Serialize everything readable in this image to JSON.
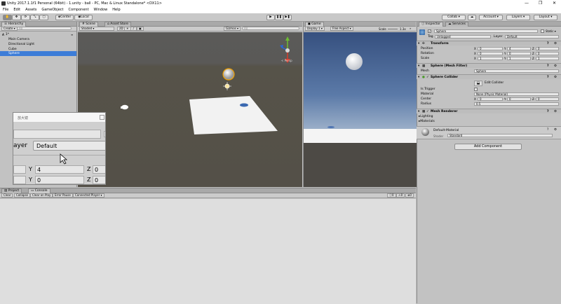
{
  "window": {
    "title": "Unity 2017.1.1f1 Personal (64bit) - 1.unity - ball - PC, Mac & Linux Standalone* <DX11>"
  },
  "menu": [
    "File",
    "Edit",
    "Assets",
    "GameObject",
    "Component",
    "Window",
    "Help"
  ],
  "toolbar": {
    "pivot": "Center",
    "space": "Local",
    "collab": "Collab ▾",
    "account": "Account ▾",
    "layers": "Layers",
    "layout": "Layout"
  },
  "hierarchy": {
    "tab": "Hierarchy",
    "create": "Create ▾",
    "search_placeholder": "All",
    "scene": "1*",
    "items": [
      "Main Camera",
      "Directional Light",
      "Cube",
      "Sphere"
    ]
  },
  "scene": {
    "tab_scene": "Scene",
    "tab_asset_store": "Asset Store",
    "shading": "Shaded",
    "mode2d": "2D",
    "gizmos": "Gizmos ▾",
    "search_placeholder": "All",
    "persp": "< Persp"
  },
  "game": {
    "tab": "Game",
    "display": "Display 1",
    "aspect": "Free Aspect",
    "scale": "Scale",
    "scale_val": "1.3x",
    "maximize": "Maximize On Play",
    "mute": "Mute Audio",
    "stats": "Stats"
  },
  "magnifier": {
    "title": "放大镜",
    "layer_label": "ayer",
    "layer_value": "Default",
    "y1_label": "Y",
    "y1_value": "4",
    "z1_label": "Z",
    "z1_value": "0",
    "y2_label": "Y",
    "y2_value": "0",
    "z2_label": "Z",
    "z2_value": "0"
  },
  "bottom": {
    "tab_project": "Project",
    "tab_console": "Console",
    "buttons": [
      "Clear",
      "Collapse",
      "Clear on Play",
      "Error Pause",
      "Connected Player ▾"
    ],
    "counts": [
      "0",
      "0",
      "0"
    ]
  },
  "inspector": {
    "tab": "Inspector",
    "tab_services": "Services",
    "object_name": "Sphere",
    "static": "Static ▾",
    "tag_label": "Tag",
    "tag_value": "Untagged",
    "layer_label": "Layer",
    "layer_value": "Default",
    "transform": {
      "title": "Transform",
      "position": {
        "label": "Position",
        "x": "0",
        "y": "4",
        "z": "0"
      },
      "rotation": {
        "label": "Rotation",
        "x": "0",
        "y": "0",
        "z": "0"
      },
      "scale": {
        "label": "Scale",
        "x": "1",
        "y": "1",
        "z": "1"
      }
    },
    "mesh_filter": {
      "title": "Sphere (Mesh Filter)",
      "mesh_label": "Mesh",
      "mesh_value": "Sphere"
    },
    "sphere_collider": {
      "title": "Sphere Collider",
      "edit": "Edit Collider",
      "trigger_label": "Is Trigger",
      "material_label": "Material",
      "material_value": "None (Physic Material)",
      "center_label": "Center",
      "cx": "0",
      "cy": "0",
      "cz": "0",
      "radius_label": "Radius",
      "radius_value": "0.5"
    },
    "mesh_renderer": {
      "title": "Mesh Renderer",
      "lighting": "Lighting",
      "materials": "Materials"
    },
    "material": {
      "name": "Default-Material",
      "shader_label": "Shader",
      "shader_value": "Standard"
    },
    "add_component": "Add Component"
  },
  "colors": {
    "scene_sky": "#5b5a58",
    "scene_ground": "#545048",
    "game_sky": "#3d5480",
    "accent_blue": "#3d7dd8"
  }
}
